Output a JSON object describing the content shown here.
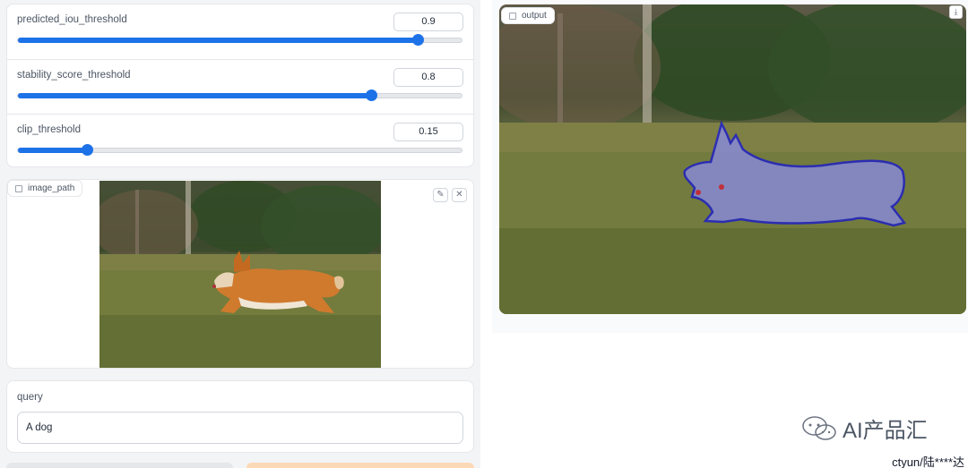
{
  "sliders": [
    {
      "label": "predicted_iou_threshold",
      "value": "0.9",
      "fraction": 0.9
    },
    {
      "label": "stability_score_threshold",
      "value": "0.8",
      "fraction": 0.8
    },
    {
      "label": "clip_threshold",
      "value": "0.15",
      "fraction": 0.15
    }
  ],
  "image_input": {
    "label": "image_path",
    "edit_icon": "pencil-icon",
    "clear_icon": "close-icon",
    "clear_glyph": "✕"
  },
  "query": {
    "label": "query",
    "value": "A dog"
  },
  "output": {
    "label": "output",
    "download_icon": "download-icon",
    "download_glyph": "⤓"
  },
  "watermark": {
    "text": "AI产品汇",
    "credit": "ctyun/陆****达"
  },
  "colors": {
    "accent": "#1d72e8",
    "mask_outline": "#1010dd",
    "mask_fill": "#8a8cf0"
  }
}
